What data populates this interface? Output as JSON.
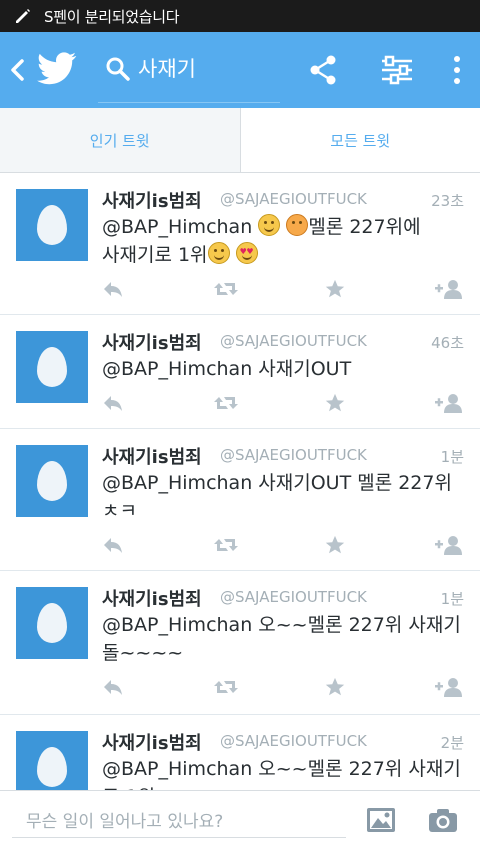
{
  "status_bar": {
    "notification": "S펜이 분리되었습니다"
  },
  "search": {
    "query": "사재기"
  },
  "tabs": [
    {
      "label": "인기 트윗",
      "active": true
    },
    {
      "label": "모든 트윗",
      "active": false
    }
  ],
  "tweets": [
    {
      "name": "사재기is범죄",
      "handle": "@SAJAEGIOUTFUCK",
      "time": "23초",
      "mention": "@BAP_Himchan",
      "text_a": "멜론 227위에",
      "text_b": "사재기로 1위"
    },
    {
      "name": "사재기is범죄",
      "handle": "@SAJAEGIOUTFUCK",
      "time": "46초",
      "text": "@BAP_Himchan 사재기OUT"
    },
    {
      "name": "사재기is범죄",
      "handle": "@SAJAEGIOUTFUCK",
      "time": "1분",
      "text": "@BAP_Himchan 사재기OUT 멜론 227위 ㅊㅋ"
    },
    {
      "name": "사재기is범죄",
      "handle": "@SAJAEGIOUTFUCK",
      "time": "1분",
      "text": "@BAP_Himchan 오~~멜론 227위 사재기돌~~~~"
    },
    {
      "name": "사재기is범죄",
      "handle": "@SAJAEGIOUTFUCK",
      "time": "2분",
      "text": "@BAP_Himchan 오~~멜론 227위 사재기로 1위"
    }
  ],
  "compose": {
    "placeholder": "무슨 일이 일어나고 있나요?"
  },
  "colors": {
    "brand": "#55acee",
    "avatar": "#3d96d9",
    "muted": "#a4afb6",
    "text": "#292f33"
  },
  "icons": [
    "pencil-icon",
    "back-arrow-icon",
    "twitter-bird-icon",
    "search-icon",
    "share-icon",
    "filter-icon",
    "more-icon",
    "reply-icon",
    "retweet-icon",
    "favorite-icon",
    "follow-icon",
    "image-icon",
    "camera-icon"
  ]
}
